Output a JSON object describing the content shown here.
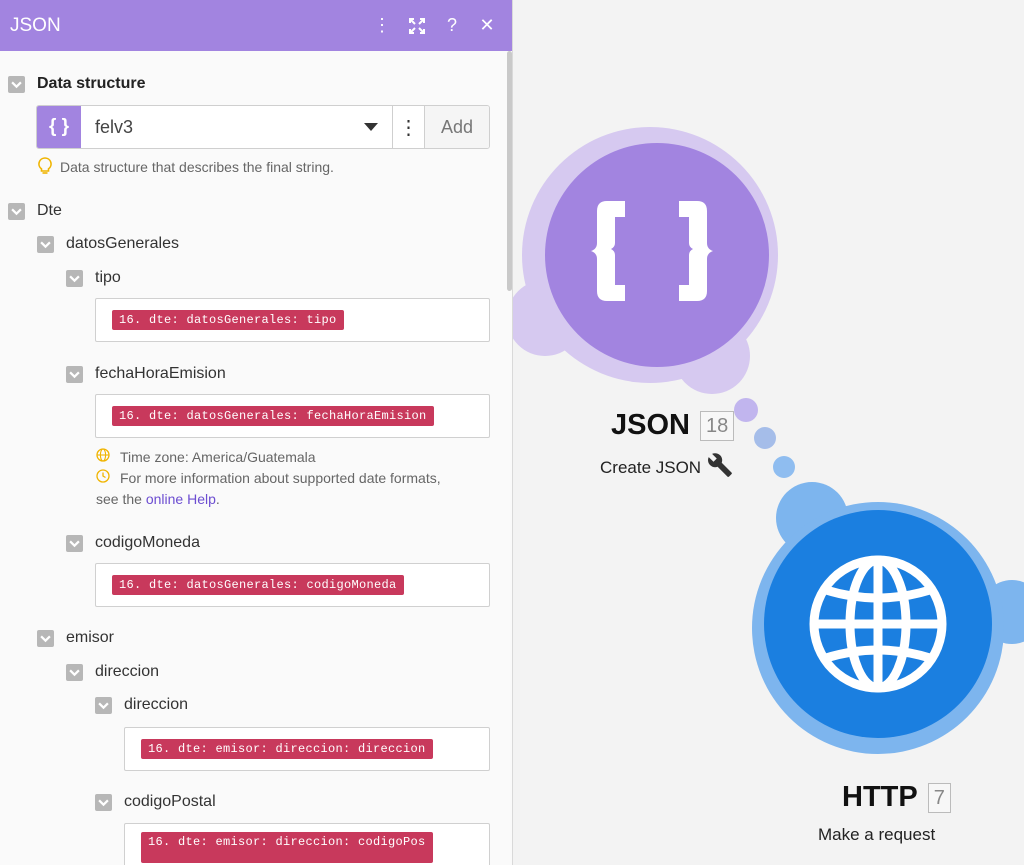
{
  "panel": {
    "title": "JSON",
    "data_structure": {
      "label": "Data structure",
      "icon_text": "{ }",
      "selected": "felv3",
      "add_label": "Add",
      "hint": "Data structure that describes the final string."
    },
    "tree": {
      "dte": "Dte",
      "datos_generales": "datosGenerales",
      "tipo": {
        "label": "tipo",
        "value": "16. dte: datosGenerales: tipo"
      },
      "fecha": {
        "label": "fechaHoraEmision",
        "value": "16. dte: datosGenerales: fechaHoraEmision",
        "timezone": "Time zone: America/Guatemala",
        "info_prefix": "For more information about supported date formats,",
        "info_see": "see the",
        "info_link": "online Help",
        "info_suffix": "."
      },
      "codigo_moneda": {
        "label": "codigoMoneda",
        "value": "16. dte: datosGenerales: codigoMoneda"
      },
      "emisor": "emisor",
      "direccion_group": "direccion",
      "direccion": {
        "label": "direccion",
        "value": "16. dte: emisor: direccion: direccion"
      },
      "codigo_postal": {
        "label": "codigoPostal",
        "value": "16. dte: emisor: direccion: codigoPos"
      }
    }
  },
  "nodes": {
    "json": {
      "title": "JSON",
      "id": "18",
      "subtitle": "Create JSON",
      "color": "#a284e0",
      "icon": "curly-braces-icon"
    },
    "http": {
      "title": "HTTP",
      "id": "7",
      "subtitle": "Make a request",
      "color": "#1b7fe0",
      "icon": "globe-icon"
    }
  },
  "colors": {
    "json_purple": "#a284e0",
    "http_blue": "#1b7fe0",
    "mapping_pill": "#c8395c",
    "link_blue": "#6c4dd1"
  }
}
